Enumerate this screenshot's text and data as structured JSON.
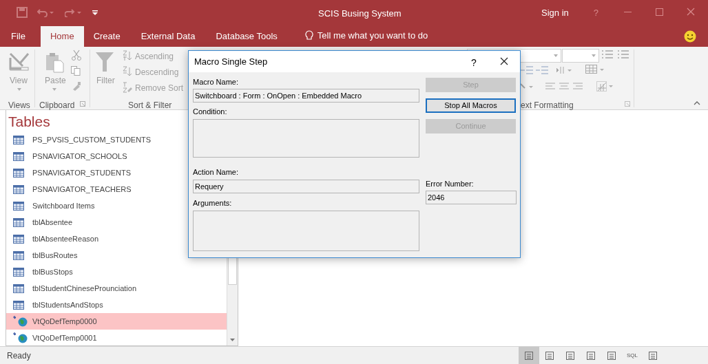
{
  "window": {
    "title": "SCIS Busing System",
    "sign_in": "Sign in",
    "help": "?"
  },
  "ribbon_tabs": [
    {
      "label": "File",
      "selected": false
    },
    {
      "label": "Home",
      "selected": true
    },
    {
      "label": "Create",
      "selected": false
    },
    {
      "label": "External Data",
      "selected": false
    },
    {
      "label": "Database Tools",
      "selected": false
    }
  ],
  "tell_me": {
    "placeholder": "Tell me what you want to do"
  },
  "ribbon": {
    "view": "View",
    "paste": "Paste",
    "filter": "Filter",
    "ascending": "Ascending",
    "descending": "Descending",
    "remove_sort": "Remove Sort",
    "groups": [
      "Views",
      "Clipboard",
      "Sort & Filter"
    ],
    "text_formatting_group": "ext Formatting"
  },
  "navigation": {
    "title": "Tables",
    "items": [
      {
        "label": "PS_PVSIS_CUSTOM_STUDENTS",
        "kind": "table",
        "selected": false
      },
      {
        "label": "PSNAVIGATOR_SCHOOLS",
        "kind": "table",
        "selected": false
      },
      {
        "label": "PSNAVIGATOR_STUDENTS",
        "kind": "table",
        "selected": false
      },
      {
        "label": "PSNAVIGATOR_TEACHERS",
        "kind": "table",
        "selected": false
      },
      {
        "label": "Switchboard Items",
        "kind": "table",
        "selected": false
      },
      {
        "label": "tblAbsentee",
        "kind": "table",
        "selected": false
      },
      {
        "label": "tblAbsenteeReason",
        "kind": "table",
        "selected": false
      },
      {
        "label": "tblBusRoutes",
        "kind": "table",
        "selected": false
      },
      {
        "label": "tblBusStops",
        "kind": "table",
        "selected": false
      },
      {
        "label": "tblStudentChineseProunciation",
        "kind": "table",
        "selected": false
      },
      {
        "label": "tblStudentsAndStops",
        "kind": "table",
        "selected": false
      },
      {
        "label": "VtQoDefTemp0000",
        "kind": "linked",
        "selected": true
      },
      {
        "label": "VtQoDefTemp0001",
        "kind": "linked",
        "selected": false
      }
    ]
  },
  "dialog": {
    "title": "Macro Single Step",
    "help": "?",
    "macro_name": {
      "label": "Macro Name:",
      "value": "Switchboard : Form : OnOpen : Embedded Macro"
    },
    "condition": {
      "label": "Condition:"
    },
    "action_name": {
      "label": "Action Name:",
      "value": "Requery"
    },
    "arguments": {
      "label": "Arguments:"
    },
    "error_number": {
      "label": "Error Number:",
      "value": "2046"
    },
    "buttons": [
      {
        "label": "Step",
        "disabled": true,
        "focused": false
      },
      {
        "label": "Stop All Macros",
        "disabled": false,
        "focused": true
      },
      {
        "label": "Continue",
        "disabled": true,
        "focused": false
      }
    ]
  },
  "status_bar": {
    "text": "Ready",
    "views": [
      {
        "kind": "icon",
        "selected": true
      },
      {
        "kind": "icon",
        "selected": false
      },
      {
        "kind": "icon",
        "selected": false
      },
      {
        "kind": "icon",
        "selected": false
      },
      {
        "kind": "icon",
        "selected": false
      },
      {
        "kind": "text",
        "label": "SQL",
        "selected": false
      },
      {
        "kind": "icon",
        "selected": false
      }
    ]
  }
}
